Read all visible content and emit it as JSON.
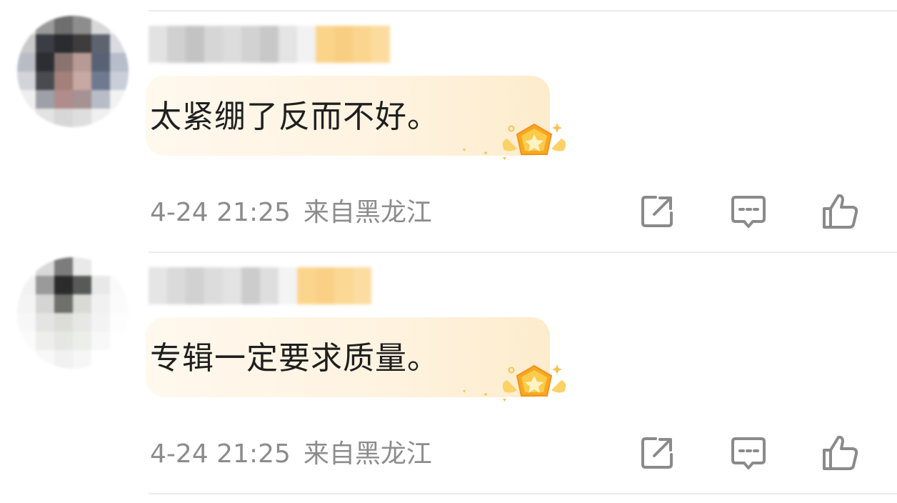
{
  "colors": {
    "text_primary": "#1f1f1f",
    "text_meta": "#8c8c8c",
    "icon": "#8a8a8a",
    "divider": "#ebebeb",
    "bubble_bg": "#fff4e4",
    "badge_gold": "#f7b733"
  },
  "comments": [
    {
      "text": "太紧绷了反而不好。",
      "time": "4-24 21:25",
      "location": "来自黑龙江",
      "icons": [
        "share-icon",
        "comment-icon",
        "like-icon"
      ]
    },
    {
      "text": "专辑一定要求质量。",
      "time": "4-24 21:25",
      "location": "来自黑龙江",
      "icons": [
        "share-icon",
        "comment-icon",
        "like-icon"
      ]
    }
  ]
}
